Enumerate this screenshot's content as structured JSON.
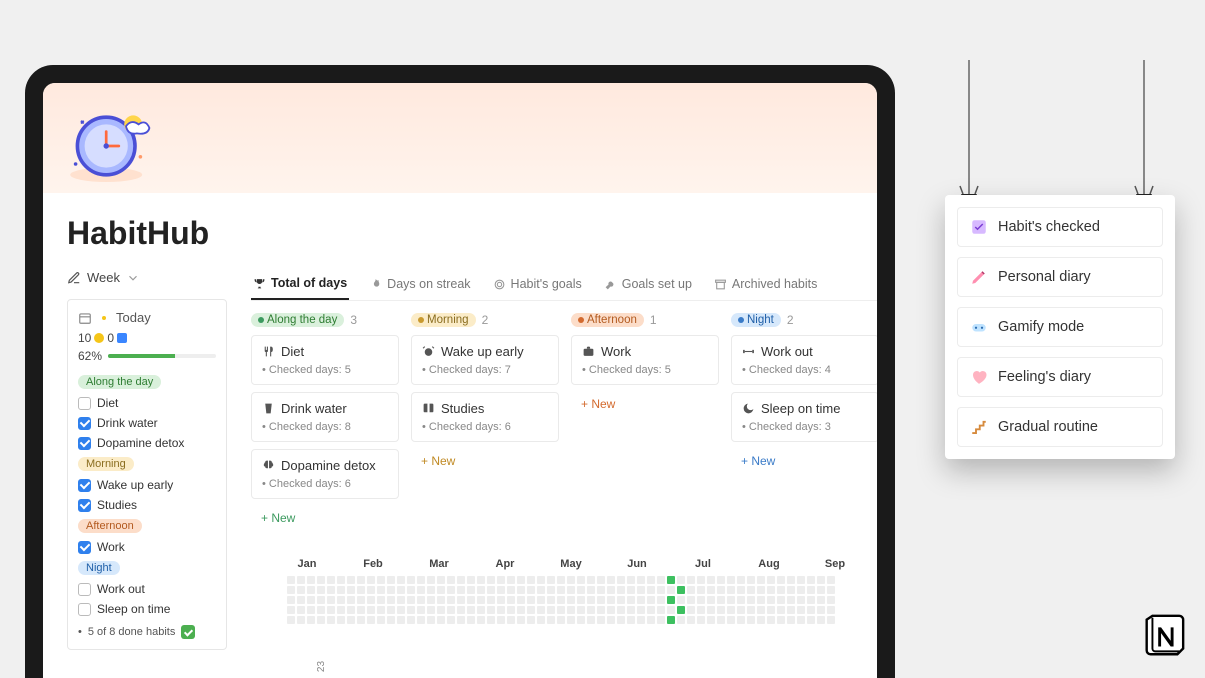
{
  "page": {
    "title": "HabitHub",
    "week_selector_label": "Week"
  },
  "sidebar": {
    "today_label": "Today",
    "coins": "10",
    "gems": "0",
    "progress_pct": "62%",
    "tags": {
      "along": "Along the day",
      "morning": "Morning",
      "afternoon": "Afternoon",
      "night": "Night"
    },
    "habits": {
      "diet": "Diet",
      "drink_water": "Drink water",
      "dopamine": "Dopamine detox",
      "wake_up": "Wake up early",
      "studies": "Studies",
      "work": "Work",
      "workout": "Work out",
      "sleep": "Sleep on time"
    },
    "summary": "5 of 8 done habits"
  },
  "tabs": {
    "total": "Total of days",
    "streak": "Days on streak",
    "goals": "Habit's goals",
    "setup": "Goals set up",
    "archived": "Archived habits"
  },
  "board": {
    "along": {
      "title": "Along the day",
      "count": "3",
      "cards": [
        {
          "title": "Diet",
          "sub": "Checked days: 5"
        },
        {
          "title": "Drink water",
          "sub": "Checked days: 8"
        },
        {
          "title": "Dopamine detox",
          "sub": "Checked days: 6"
        }
      ],
      "new": "New"
    },
    "morning": {
      "title": "Morning",
      "count": "2",
      "cards": [
        {
          "title": "Wake up early",
          "sub": "Checked days: 7"
        },
        {
          "title": "Studies",
          "sub": "Checked days: 6"
        }
      ],
      "new": "New"
    },
    "afternoon": {
      "title": "Afternoon",
      "count": "1",
      "cards": [
        {
          "title": "Work",
          "sub": "Checked days: 5"
        }
      ],
      "new": "New"
    },
    "night": {
      "title": "Night",
      "count": "2",
      "cards": [
        {
          "title": "Work out",
          "sub": "Checked days: 4"
        },
        {
          "title": "Sleep on time",
          "sub": "Checked days: 3"
        }
      ],
      "new": "New"
    }
  },
  "months": [
    "Jan",
    "Feb",
    "Mar",
    "Apr",
    "May",
    "Jun",
    "Jul",
    "Aug",
    "Sep"
  ],
  "year": "23",
  "panel": {
    "items": [
      "Habit's checked",
      "Personal diary",
      "Gamify mode",
      "Feeling's diary",
      "Gradual routine"
    ]
  }
}
